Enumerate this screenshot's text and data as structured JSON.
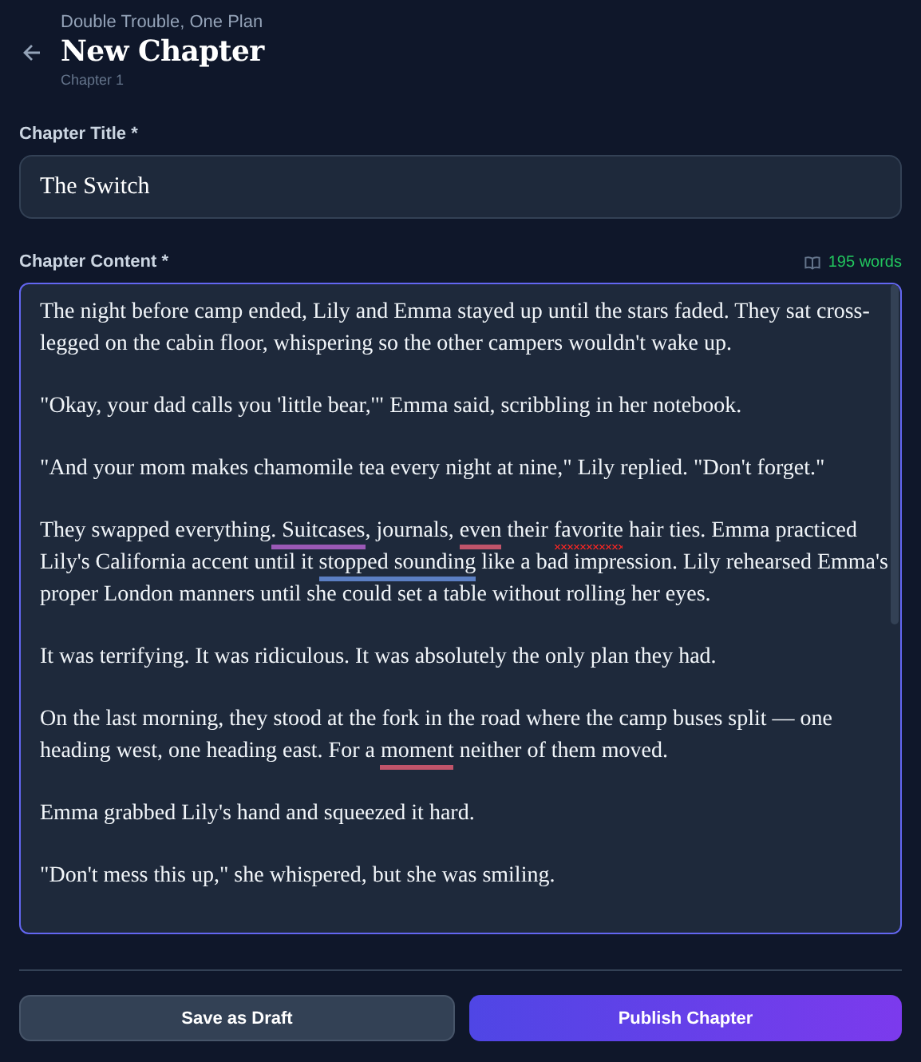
{
  "header": {
    "breadcrumb": "Double Trouble, One Plan",
    "title": "New Chapter",
    "subtitle": "Chapter 1"
  },
  "title_field": {
    "label": "Chapter Title *",
    "value": "The Switch"
  },
  "content_field": {
    "label": "Chapter Content *",
    "word_count": "195 words",
    "paragraphs": [
      [
        {
          "text": "The night before camp ended, Lily and Emma stayed up until the stars faded. They sat cross-legged on the cabin floor, whispering so the other campers wouldn't wake up."
        }
      ],
      [
        {
          "text": "\"Okay, your dad calls you 'little bear,'\" Emma said, scribbling in her notebook."
        }
      ],
      [
        {
          "text": "\"And your mom makes chamomile tea every night at nine,\" Lily replied. \"Don't forget.\""
        }
      ],
      [
        {
          "text": "They swapped everything"
        },
        {
          "text": ". Suitcases",
          "kind": "straight",
          "color": "#9b59b6"
        },
        {
          "text": ", journals, "
        },
        {
          "text": "even",
          "kind": "straight",
          "color": "#c0546a"
        },
        {
          "text": " their "
        },
        {
          "text": "favorite",
          "kind": "wavy",
          "color": "#dc2626"
        },
        {
          "text": " hair ties. Emma practiced Lily's California accent until it "
        },
        {
          "text": "stopped sounding",
          "kind": "straight",
          "color": "#5b7fc4"
        },
        {
          "text": " like a bad impression. Lily rehearsed Emma's proper London manners until she could set a table without rolling her eyes."
        }
      ],
      [
        {
          "text": "It was terrifying. It was ridiculous. It was absolutely the only plan they had."
        }
      ],
      [
        {
          "text": "On the last morning, they stood at the fork in the road where the camp buses split — one heading west, one heading east. For a "
        },
        {
          "text": "moment",
          "kind": "straight",
          "color": "#c0546a"
        },
        {
          "text": " neither of them moved."
        }
      ],
      [
        {
          "text": "Emma grabbed Lily's hand and squeezed it hard."
        }
      ],
      [
        {
          "text": "\"Don't mess this up,\" she whispered, but she was smiling."
        }
      ]
    ]
  },
  "buttons": [
    {
      "label": "Save as Draft",
      "kind": "secondary"
    },
    {
      "label": "Publish Chapter",
      "kind": "primary"
    }
  ]
}
